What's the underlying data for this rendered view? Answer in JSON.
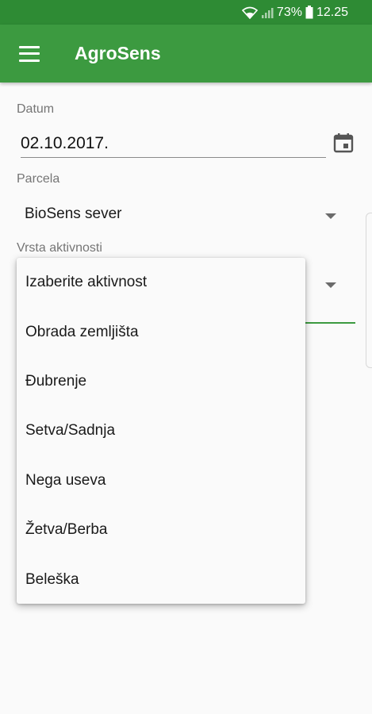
{
  "status_bar": {
    "battery_percent": "73%",
    "time": "12.25",
    "icons": [
      "wifi-icon",
      "signal-icon",
      "battery-icon"
    ]
  },
  "app_bar": {
    "title": "AgroSens",
    "menu_icon": "menu-icon",
    "color": "#3c9a40"
  },
  "form": {
    "date_label": "Datum",
    "date_value": "02.10.2017.",
    "calendar_icon": "calendar-icon",
    "parcel_label": "Parcela",
    "parcel_value": "BioSens sever",
    "activity_label": "Vrsta aktivnosti"
  },
  "activity_dropdown": {
    "options": [
      "Izaberite aktivnost",
      "Obrada zemljišta",
      "Đubrenje",
      "Setva/Sadnja",
      "Nega useva",
      "Žetva/Berba",
      "Beleška"
    ]
  }
}
